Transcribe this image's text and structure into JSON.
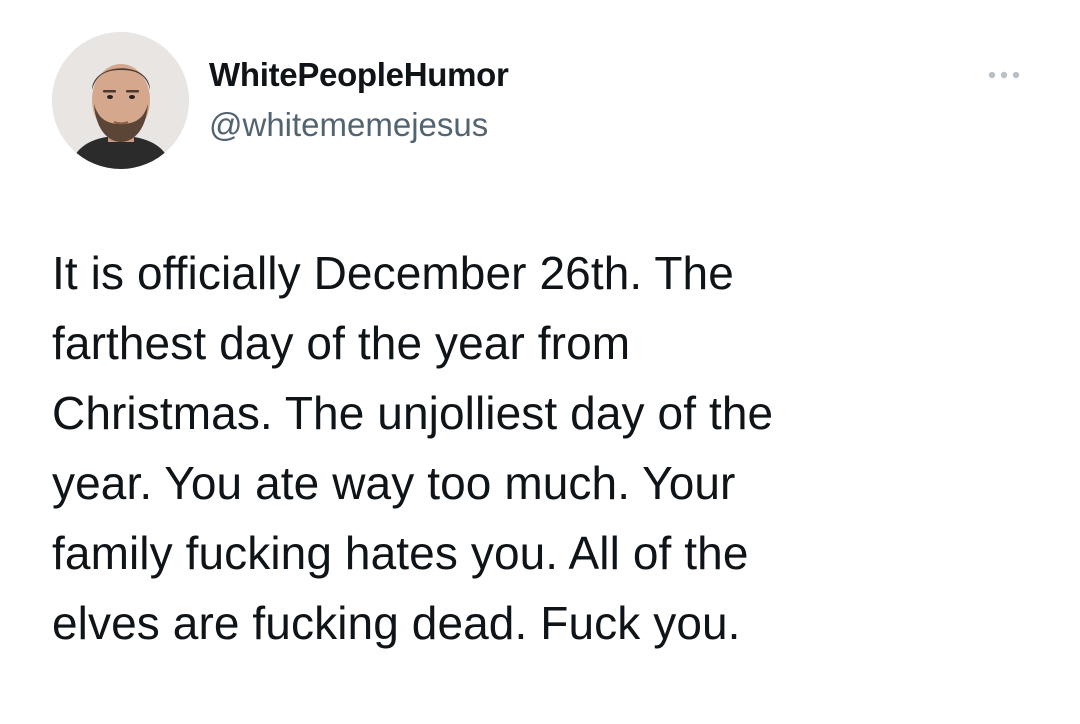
{
  "author": {
    "display_name": "WhitePeopleHumor",
    "handle": "@whitememejesus"
  },
  "more_icon": "ellipsis-icon",
  "tweet": {
    "lines": [
      "It is officially December 26th. The",
      "farthest day of the year from",
      "Christmas. The unjolliest day of the",
      "year. You ate way too much. Your",
      "family fucking hates you. All of the",
      "elves are fucking dead. Fuck you."
    ]
  },
  "colors": {
    "text_primary": "#0f1419",
    "text_secondary": "#536471",
    "icon_gray": "#b9c0c6"
  }
}
